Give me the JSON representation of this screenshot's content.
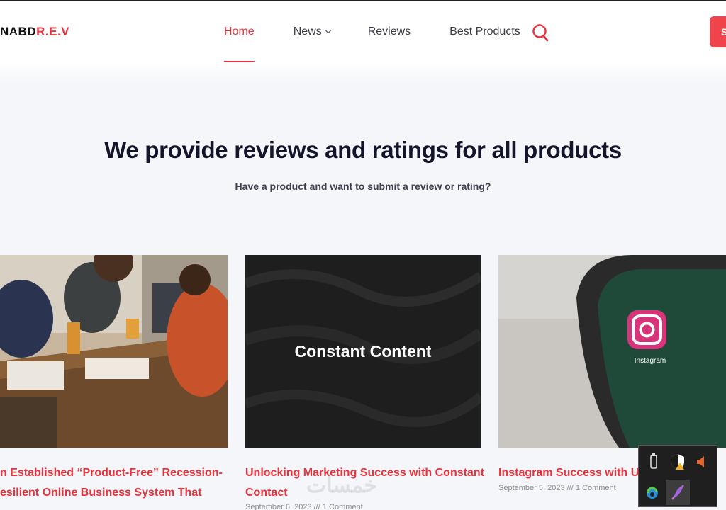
{
  "header": {
    "logo_dark": "NABD",
    "logo_red": "R.E.V",
    "nav": {
      "home": "Home",
      "news": "News",
      "reviews": "Reviews",
      "best_products": "Best Products"
    },
    "cta_label": "S"
  },
  "hero": {
    "title": "We provide reviews and ratings for all products",
    "subtitle": "Have a product and want to submit a review or rating?"
  },
  "cards": [
    {
      "title_line1": "n Established “Product-Free” Recession-",
      "title_line2": "esilient Online Business System That"
    },
    {
      "image_text": "Constant Content",
      "title_line1": "Unlocking Marketing Success with Constant",
      "title_line2": "Contact",
      "meta": "September 6, 2023 /// 1 Comment"
    },
    {
      "image_text": "Instagram",
      "title_line1": "Instagram Success with Uple",
      "meta": "September 5, 2023 /// 1 Comment"
    }
  ],
  "watermark": "خمسات",
  "colors": {
    "accent": "#e8323c",
    "title": "#14142b",
    "background": "#f4f6f9"
  }
}
